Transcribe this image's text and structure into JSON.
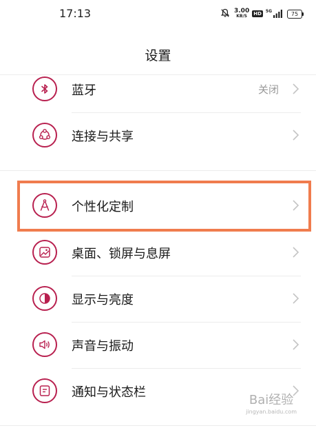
{
  "status_bar": {
    "time": "17:13",
    "net_speed_value": "3.00",
    "net_speed_unit": "KB/S",
    "hd_label": "HD",
    "signal_label": "5G",
    "battery": "75"
  },
  "header": {
    "title": "设置"
  },
  "settings": {
    "bluetooth": {
      "label": "蓝牙",
      "value": "关闭"
    },
    "connect_share": {
      "label": "连接与共享"
    },
    "personalize": {
      "label": "个性化定制"
    },
    "desktop_lock": {
      "label": "桌面、锁屏与息屏"
    },
    "display": {
      "label": "显示与亮度"
    },
    "sound": {
      "label": "声音与振动"
    },
    "notification": {
      "label": "通知与状态栏"
    }
  },
  "watermark": {
    "logo": "Bai经验",
    "url": "jingyan.baidu.com"
  },
  "colors": {
    "icon_accent": "#b8204f",
    "highlight": "#f07c4e",
    "secondary_text": "#999999"
  }
}
